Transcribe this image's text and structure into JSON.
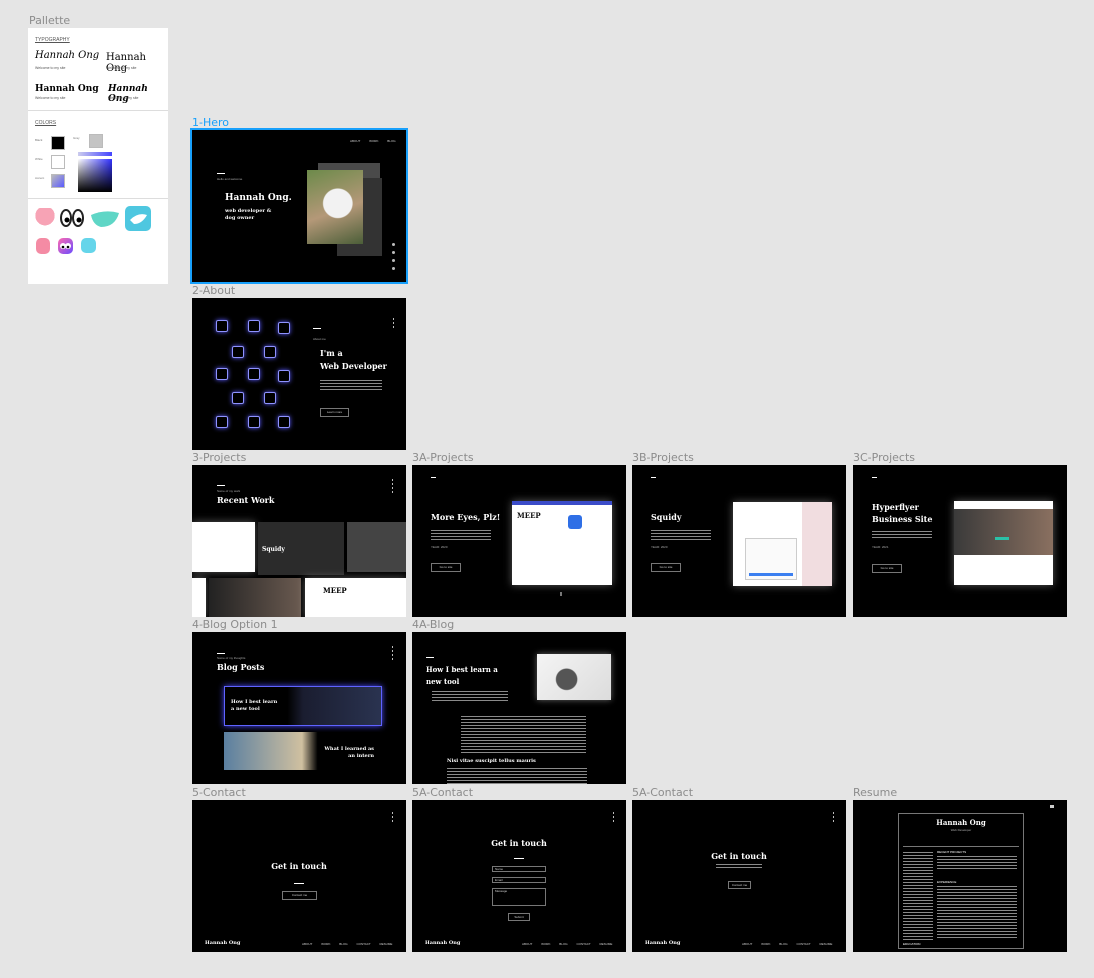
{
  "palette": {
    "label": "Pallette",
    "typography_heading": "TYPOGRAPHY",
    "font_samples": [
      {
        "name": "Hannah Ong",
        "sub": "Welcome to my site"
      },
      {
        "name": "Hannah Ong",
        "sub": "Welcome to my site"
      },
      {
        "name": "Hannah Ong",
        "sub": "Welcome to my site"
      },
      {
        "name": "Hannah Ong",
        "sub": "Welcome to my site"
      }
    ],
    "colors_heading": "COLORS",
    "colors": [
      {
        "name": "Black",
        "hex": "#000000"
      },
      {
        "name": "Gray",
        "hex": "#c4c4c4"
      },
      {
        "name": "White",
        "hex": "#ffffff"
      },
      {
        "name": "Accent",
        "hex": "#5b5bff"
      }
    ],
    "mascots": [
      "octopus-icon",
      "eyes-icon",
      "whale-icon",
      "bird-icon",
      "octopus-icon",
      "eyes-icon",
      "bird-icon"
    ]
  },
  "frames": {
    "hero": {
      "label": "1-Hero",
      "kicker": "Hello and welcome",
      "name": "Hannah Ong.",
      "tagline": "web developer & dog owner",
      "nav": "ABOUT WORK BLOG"
    },
    "about": {
      "label": "2-About",
      "kicker": "About me",
      "title_line1": "I'm a",
      "title_line2": "Web Developer",
      "button": "Learn more"
    },
    "projects": {
      "label": "3-Projects",
      "kicker": "Some of my work",
      "title": "Recent Work",
      "card_title": "Squidy",
      "card_meep": "MEEP"
    },
    "project_a": {
      "label": "3A-Projects",
      "title": "More Eyes, Plz!",
      "meta": "YEAR: 2020",
      "button": "Go to site",
      "shot_title": "MEEP"
    },
    "project_b": {
      "label": "3B-Projects",
      "title": "Squidy",
      "meta": "YEAR: 2020",
      "button": "Go to site"
    },
    "project_c": {
      "label": "3C-Projects",
      "title_line1": "Hyperflyer",
      "title_line2": "Business Site",
      "meta": "YEAR: 2021",
      "button": "Go to site"
    },
    "blog": {
      "label": "4-Blog Option 1",
      "kicker": "Some of my thoughts",
      "title": "Blog Posts",
      "post1": "How I best learn a new tool",
      "post2": "What I learned as an intern"
    },
    "blog_a": {
      "label": "4A-Blog",
      "title_line1": "How I best learn a",
      "title_line2": "new tool",
      "subhead": "Nisi vitae suscipit tellus mauris"
    },
    "contact": {
      "label": "5-Contact",
      "title": "Get in touch",
      "button": "Contact me",
      "logo": "Hannah Ong",
      "nav": "ABOUT WORK BLOG CONTACT RESUME"
    },
    "contact_a": {
      "label": "5A-Contact",
      "title": "Get in touch",
      "fields": [
        "Name",
        "Email",
        "Message"
      ],
      "button": "Submit",
      "logo": "Hannah Ong",
      "nav": "ABOUT WORK BLOG CONTACT RESUME"
    },
    "contact_b": {
      "label": "5A-Contact",
      "title": "Get in touch",
      "button": "Contact me",
      "logo": "Hannah Ong",
      "nav": "ABOUT WORK BLOG CONTACT RESUME"
    },
    "resume": {
      "label": "Resume",
      "name": "Hannah Ong",
      "subtitle": "Web Developer",
      "sections": [
        "RECENT PROJECTS",
        "EXPERIENCE",
        "EDUCATION"
      ]
    }
  }
}
